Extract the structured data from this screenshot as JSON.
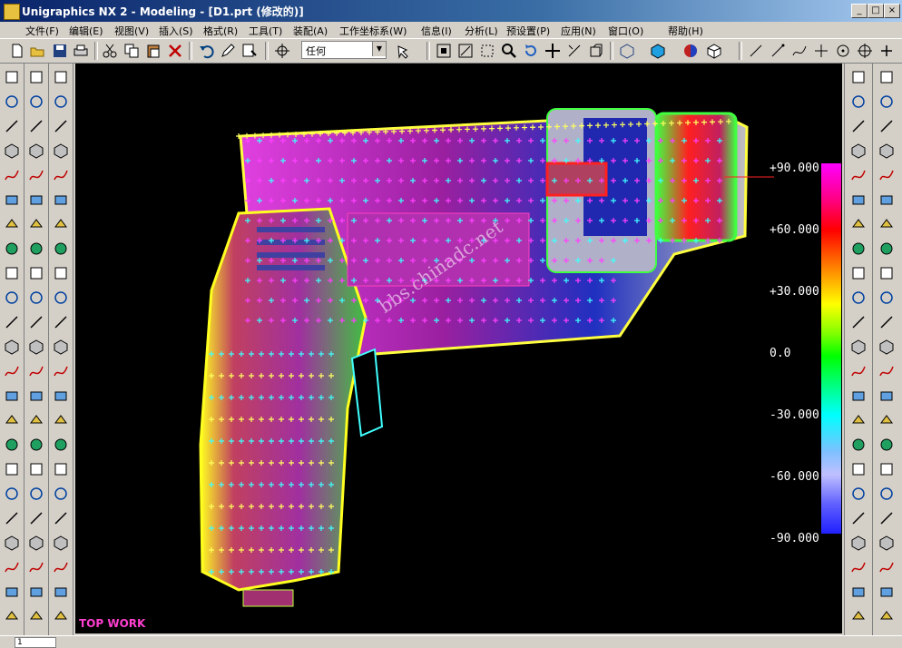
{
  "window": {
    "title": "Unigraphics NX 2 - Modeling - [D1.prt (修改的)]",
    "minimize": "_",
    "maximize": "□",
    "close": "×"
  },
  "menu": [
    "文件(F)",
    "编辑(E)",
    "视图(V)",
    "插入(S)",
    "格式(R)",
    "工具(T)",
    "装配(A)",
    "工作坐标系(W)",
    "信息(I)",
    "分析(L)",
    "预设置(P)",
    "应用(N)",
    "窗口(O)",
    "帮助(H)"
  ],
  "toolbar": {
    "selection_filter": "任何"
  },
  "viewport": {
    "view_label": "TOP WORK",
    "watermark": "bbs.chinadc.net",
    "colors": {
      "background": "#000000",
      "label": "#ff3fd0"
    }
  },
  "draft_scale": {
    "labels": [
      "+90.000",
      "+60.000",
      "+30.000",
      "0.0",
      "-30.000",
      "-60.000",
      "-90.000"
    ]
  },
  "statusbar": {
    "layer_value": "1"
  },
  "icons": {
    "left_col1": [
      "point-icon",
      "arc-icon",
      "spline-icon",
      "plus-icon",
      "points-icon",
      "line-icon",
      "rectangle-icon",
      "circle-icon",
      "ellipse-icon",
      "offset-icon",
      "helix-icon",
      "sphere-icon",
      "law-icon",
      "project-icon",
      "combine-icon",
      "bridge-icon",
      "intersect-icon",
      "section-icon",
      "extract-icon",
      "wrap-icon",
      "trim-icon",
      "edit-icon",
      "move-icon"
    ],
    "left_col2": [
      "sketch-icon",
      "extrude-icon",
      "revolve-icon",
      "sweep-icon",
      "tube-icon",
      "hole-icon",
      "boss-icon",
      "pocket-icon",
      "pad-icon",
      "slot-icon",
      "groove-icon",
      "feature-icon",
      "thread-icon",
      "blend-icon",
      "chamfer-icon",
      "shell-icon",
      "taper-icon",
      "offset-face-icon",
      "scale-icon",
      "block-icon",
      "cylinder-icon",
      "cone-icon",
      "sphere-prim-icon"
    ],
    "right_col1": [
      "surface-icon",
      "ruled-icon",
      "mesh-icon",
      "swept-icon",
      "section-surf-icon",
      "bridge-surf-icon",
      "nsided-icon",
      "extension-icon",
      "offset-surf-icon",
      "trim-surf-icon",
      "fillet-surf-icon",
      "sew-icon",
      "patch-icon",
      "thicken-icon",
      "quilt-icon",
      "enlarge-icon",
      "global-shape-icon",
      "cube-icon",
      "cube2-icon",
      "pattern-icon",
      "mirror-icon",
      "analysis-icon",
      "curvature-icon"
    ],
    "right_col2": [
      "edit-surf-icon",
      "move-pole-icon",
      "x-form-icon",
      "change-edge-icon",
      "change-degree-icon",
      "change-stiffness-icon",
      "refit-icon",
      "smooth-icon",
      "reverse-icon",
      "trim-body-icon",
      "split-icon",
      "blend-surf-icon",
      "fillet2-icon",
      "chamfer2-icon",
      "draft-icon",
      "taper2-icon",
      "unite-icon",
      "subtract-icon",
      "intersect2-icon",
      "instance-icon",
      "promote-icon",
      "delete-icon",
      "undo-icon"
    ]
  }
}
